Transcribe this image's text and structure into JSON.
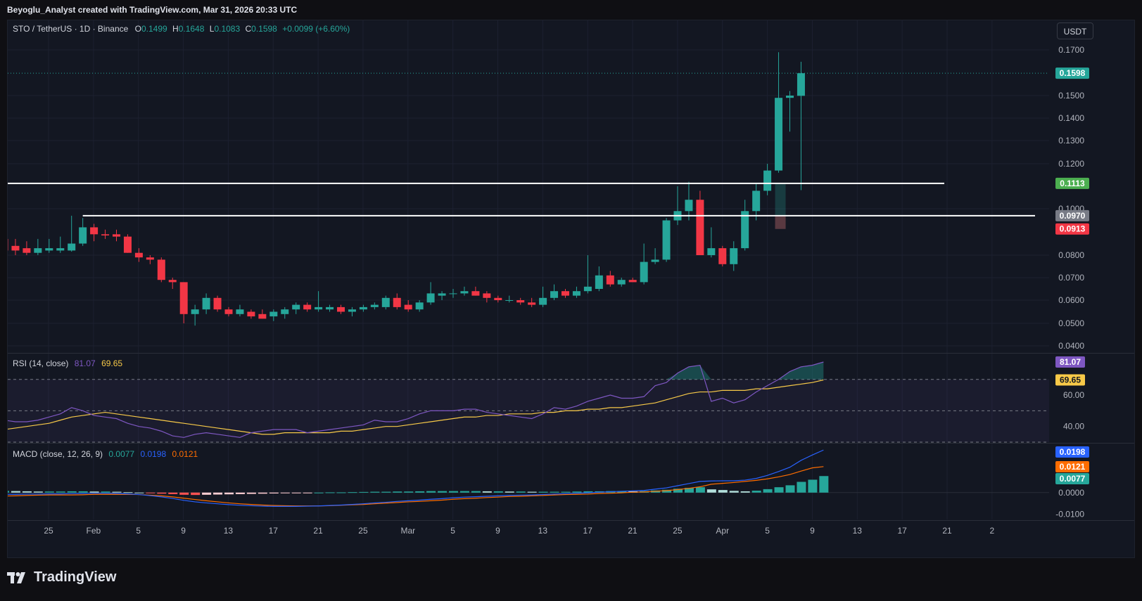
{
  "header": {
    "credit": "Beyoglu_Analyst created with TradingView.com, Mar 31, 2026 20:33 UTC"
  },
  "symbol": {
    "pair": "STO / TetherUS · 1D · Binance",
    "o_label": "O",
    "o_value": "0.1499",
    "h_label": "H",
    "h_value": "0.1648",
    "l_label": "L",
    "l_value": "0.1083",
    "c_label": "C",
    "c_value": "0.1598",
    "change": "+0.0099 (+6.60%)"
  },
  "currency_button": "USDT",
  "rsi": {
    "title": "RSI (14, close)",
    "value": "81.07",
    "ma_value": "69.65"
  },
  "macd": {
    "title": "MACD (close, 12, 26, 9)",
    "hist": "0.0077",
    "macd": "0.0198",
    "signal": "0.0121"
  },
  "branding": "TradingView",
  "colors": {
    "up": "#26a69a",
    "down": "#f23645",
    "rsi_line": "#7e57c2",
    "rsi_ma": "#f7c948",
    "macd_line": "#2962ff",
    "signal_line": "#ff6d00",
    "background": "#131722"
  },
  "chart_data": [
    {
      "type": "candlestick",
      "title": "STO / TetherUS · 1D · Binance",
      "y_axis_ticks": [
        "0.1700",
        "0.1500",
        "0.1400",
        "0.1300",
        "0.1200",
        "0.1000",
        "0.0800",
        "0.0700",
        "0.0600",
        "0.0500",
        "0.0400"
      ],
      "ylim": [
        0.036,
        0.178
      ],
      "x_axis_ticks": [
        "25",
        "Feb",
        "5",
        "9",
        "13",
        "17",
        "21",
        "25",
        "Mar",
        "5",
        "9",
        "13",
        "17",
        "21",
        "25",
        "Apr",
        "5",
        "9",
        "13",
        "17",
        "21",
        "2"
      ],
      "price_badges": [
        {
          "label": "0.1598",
          "value": 0.1598,
          "color": "#26a69a"
        },
        {
          "label": "0.1113",
          "value": 0.1113,
          "color": "#4caf50"
        },
        {
          "label": "0.0970",
          "value": 0.097,
          "color": "#787b86"
        },
        {
          "label": "0.0913",
          "value": 0.0913,
          "color": "#f23645"
        }
      ],
      "horizontal_lines": [
        {
          "value": 0.1113,
          "from": "Jan 19",
          "to": "Apr 14"
        },
        {
          "value": 0.097,
          "from": "Jan 26",
          "to": "Apr 22"
        }
      ],
      "candles": [
        {
          "d": "Jan 19",
          "o": 0.087,
          "h": 0.088,
          "l": 0.081,
          "c": 0.082
        },
        {
          "d": "Jan 20",
          "o": 0.084,
          "h": 0.087,
          "l": 0.08,
          "c": 0.082
        },
        {
          "d": "Jan 21",
          "o": 0.083,
          "h": 0.086,
          "l": 0.08,
          "c": 0.081
        },
        {
          "d": "Jan 22",
          "o": 0.081,
          "h": 0.087,
          "l": 0.08,
          "c": 0.083
        },
        {
          "d": "Jan 23",
          "o": 0.082,
          "h": 0.087,
          "l": 0.081,
          "c": 0.083
        },
        {
          "d": "Jan 24",
          "o": 0.082,
          "h": 0.088,
          "l": 0.081,
          "c": 0.083
        },
        {
          "d": "Jan 25",
          "o": 0.082,
          "h": 0.097,
          "l": 0.0815,
          "c": 0.085
        },
        {
          "d": "Jan 26",
          "o": 0.085,
          "h": 0.096,
          "l": 0.084,
          "c": 0.092
        },
        {
          "d": "Jan 27",
          "o": 0.092,
          "h": 0.0935,
          "l": 0.086,
          "c": 0.089
        },
        {
          "d": "Jan 28",
          "o": 0.089,
          "h": 0.091,
          "l": 0.087,
          "c": 0.0885
        },
        {
          "d": "Jan 29",
          "o": 0.089,
          "h": 0.091,
          "l": 0.086,
          "c": 0.088
        },
        {
          "d": "Jan 30",
          "o": 0.088,
          "h": 0.089,
          "l": 0.081,
          "c": 0.081
        },
        {
          "d": "Jan 31",
          "o": 0.081,
          "h": 0.083,
          "l": 0.077,
          "c": 0.079
        },
        {
          "d": "Feb 1",
          "o": 0.079,
          "h": 0.08,
          "l": 0.076,
          "c": 0.078
        },
        {
          "d": "Feb 2",
          "o": 0.078,
          "h": 0.079,
          "l": 0.068,
          "c": 0.069
        },
        {
          "d": "Feb 3",
          "o": 0.069,
          "h": 0.07,
          "l": 0.065,
          "c": 0.068
        },
        {
          "d": "Feb 4",
          "o": 0.068,
          "h": 0.068,
          "l": 0.05,
          "c": 0.054
        },
        {
          "d": "Feb 5",
          "o": 0.054,
          "h": 0.058,
          "l": 0.049,
          "c": 0.056
        },
        {
          "d": "Feb 6",
          "o": 0.056,
          "h": 0.063,
          "l": 0.054,
          "c": 0.061
        },
        {
          "d": "Feb 7",
          "o": 0.061,
          "h": 0.062,
          "l": 0.055,
          "c": 0.056
        },
        {
          "d": "Feb 8",
          "o": 0.056,
          "h": 0.057,
          "l": 0.053,
          "c": 0.054
        },
        {
          "d": "Feb 9",
          "o": 0.054,
          "h": 0.058,
          "l": 0.053,
          "c": 0.056
        },
        {
          "d": "Feb 10",
          "o": 0.055,
          "h": 0.056,
          "l": 0.052,
          "c": 0.053
        },
        {
          "d": "Feb 11",
          "o": 0.054,
          "h": 0.056,
          "l": 0.052,
          "c": 0.052
        },
        {
          "d": "Feb 12",
          "o": 0.053,
          "h": 0.056,
          "l": 0.051,
          "c": 0.055
        },
        {
          "d": "Feb 13",
          "o": 0.054,
          "h": 0.057,
          "l": 0.052,
          "c": 0.056
        },
        {
          "d": "Feb 14",
          "o": 0.056,
          "h": 0.059,
          "l": 0.054,
          "c": 0.058
        },
        {
          "d": "Feb 15",
          "o": 0.058,
          "h": 0.059,
          "l": 0.055,
          "c": 0.056
        },
        {
          "d": "Feb 16",
          "o": 0.056,
          "h": 0.064,
          "l": 0.055,
          "c": 0.057
        },
        {
          "d": "Feb 17",
          "o": 0.056,
          "h": 0.058,
          "l": 0.055,
          "c": 0.057
        },
        {
          "d": "Feb 18",
          "o": 0.057,
          "h": 0.058,
          "l": 0.054,
          "c": 0.055
        },
        {
          "d": "Feb 19",
          "o": 0.055,
          "h": 0.057,
          "l": 0.053,
          "c": 0.056
        },
        {
          "d": "Feb 20",
          "o": 0.056,
          "h": 0.058,
          "l": 0.055,
          "c": 0.057
        },
        {
          "d": "Feb 21",
          "o": 0.057,
          "h": 0.059,
          "l": 0.056,
          "c": 0.058
        },
        {
          "d": "Feb 22",
          "o": 0.057,
          "h": 0.062,
          "l": 0.056,
          "c": 0.061
        },
        {
          "d": "Feb 23",
          "o": 0.061,
          "h": 0.063,
          "l": 0.056,
          "c": 0.057
        },
        {
          "d": "Feb 24",
          "o": 0.058,
          "h": 0.06,
          "l": 0.055,
          "c": 0.056
        },
        {
          "d": "Feb 25",
          "o": 0.056,
          "h": 0.06,
          "l": 0.055,
          "c": 0.059
        },
        {
          "d": "Feb 26",
          "o": 0.059,
          "h": 0.068,
          "l": 0.058,
          "c": 0.063
        },
        {
          "d": "Feb 27",
          "o": 0.062,
          "h": 0.064,
          "l": 0.06,
          "c": 0.063
        },
        {
          "d": "Feb 28",
          "o": 0.063,
          "h": 0.065,
          "l": 0.061,
          "c": 0.063
        },
        {
          "d": "Mar 1",
          "o": 0.063,
          "h": 0.066,
          "l": 0.062,
          "c": 0.064
        },
        {
          "d": "Mar 2",
          "o": 0.064,
          "h": 0.066,
          "l": 0.062,
          "c": 0.062
        },
        {
          "d": "Mar 3",
          "o": 0.063,
          "h": 0.064,
          "l": 0.059,
          "c": 0.061
        },
        {
          "d": "Mar 4",
          "o": 0.061,
          "h": 0.062,
          "l": 0.059,
          "c": 0.06
        },
        {
          "d": "Mar 5",
          "o": 0.06,
          "h": 0.062,
          "l": 0.059,
          "c": 0.06
        },
        {
          "d": "Mar 6",
          "o": 0.06,
          "h": 0.061,
          "l": 0.058,
          "c": 0.059
        },
        {
          "d": "Mar 7",
          "o": 0.059,
          "h": 0.061,
          "l": 0.057,
          "c": 0.058
        },
        {
          "d": "Mar 8",
          "o": 0.058,
          "h": 0.066,
          "l": 0.057,
          "c": 0.061
        },
        {
          "d": "Mar 9",
          "o": 0.061,
          "h": 0.067,
          "l": 0.06,
          "c": 0.064
        },
        {
          "d": "Mar 10",
          "o": 0.064,
          "h": 0.065,
          "l": 0.061,
          "c": 0.062
        },
        {
          "d": "Mar 11",
          "o": 0.062,
          "h": 0.066,
          "l": 0.061,
          "c": 0.064
        },
        {
          "d": "Mar 12",
          "o": 0.064,
          "h": 0.08,
          "l": 0.063,
          "c": 0.066
        },
        {
          "d": "Mar 13",
          "o": 0.065,
          "h": 0.075,
          "l": 0.064,
          "c": 0.071
        },
        {
          "d": "Mar 14",
          "o": 0.071,
          "h": 0.073,
          "l": 0.066,
          "c": 0.067
        },
        {
          "d": "Mar 15",
          "o": 0.067,
          "h": 0.07,
          "l": 0.066,
          "c": 0.069
        },
        {
          "d": "Mar 16",
          "o": 0.069,
          "h": 0.07,
          "l": 0.068,
          "c": 0.068
        },
        {
          "d": "Mar 17",
          "o": 0.068,
          "h": 0.085,
          "l": 0.067,
          "c": 0.077
        },
        {
          "d": "Mar 18",
          "o": 0.077,
          "h": 0.083,
          "l": 0.076,
          "c": 0.078
        },
        {
          "d": "Mar 19",
          "o": 0.078,
          "h": 0.096,
          "l": 0.077,
          "c": 0.095
        },
        {
          "d": "Mar 20",
          "o": 0.095,
          "h": 0.11,
          "l": 0.093,
          "c": 0.099
        },
        {
          "d": "Mar 21",
          "o": 0.099,
          "h": 0.112,
          "l": 0.095,
          "c": 0.104
        },
        {
          "d": "Mar 22",
          "o": 0.104,
          "h": 0.108,
          "l": 0.08,
          "c": 0.08
        },
        {
          "d": "Mar 23",
          "o": 0.08,
          "h": 0.092,
          "l": 0.079,
          "c": 0.083
        },
        {
          "d": "Mar 24",
          "o": 0.083,
          "h": 0.084,
          "l": 0.075,
          "c": 0.076
        },
        {
          "d": "Mar 25",
          "o": 0.076,
          "h": 0.086,
          "l": 0.073,
          "c": 0.083
        },
        {
          "d": "Mar 26",
          "o": 0.083,
          "h": 0.104,
          "l": 0.082,
          "c": 0.099
        },
        {
          "d": "Mar 27",
          "o": 0.099,
          "h": 0.111,
          "l": 0.095,
          "c": 0.108
        },
        {
          "d": "Mar 28",
          "o": 0.108,
          "h": 0.12,
          "l": 0.106,
          "c": 0.117
        },
        {
          "d": "Mar 29",
          "o": 0.117,
          "h": 0.169,
          "l": 0.116,
          "c": 0.149
        },
        {
          "d": "Mar 30",
          "o": 0.149,
          "h": 0.152,
          "l": 0.134,
          "c": 0.15
        },
        {
          "d": "Mar 31",
          "o": 0.1499,
          "h": 0.1648,
          "l": 0.1083,
          "c": 0.1598
        }
      ]
    },
    {
      "type": "line",
      "title": "RSI (14, close)",
      "y_axis_ticks": [
        "60.00",
        "40.00"
      ],
      "ylim": [
        30,
        86
      ],
      "bands": [
        70,
        50,
        30
      ],
      "series": [
        {
          "values": [
            44,
            43,
            43,
            44,
            46,
            48,
            52,
            50,
            47,
            46,
            45,
            42,
            40,
            39,
            37,
            34,
            33,
            35,
            36,
            35,
            34,
            33,
            36,
            37,
            38,
            38,
            38,
            36,
            37,
            38,
            39,
            40,
            41,
            44,
            43,
            43,
            45,
            48,
            50,
            50,
            50,
            51,
            51,
            49,
            48,
            47,
            46,
            45,
            48,
            52,
            51,
            53,
            56,
            58,
            60,
            58,
            58,
            59,
            66,
            68,
            74,
            78,
            79,
            56,
            58,
            55,
            57,
            62,
            66,
            70,
            75,
            78,
            79,
            81.07
          ]
        },
        {
          "values": [
            38,
            39,
            40,
            41,
            42,
            44,
            46,
            47,
            48,
            49,
            48,
            47,
            46,
            45,
            44,
            43,
            42,
            41,
            40,
            39,
            38,
            37,
            36,
            35,
            35,
            36,
            36,
            36,
            36,
            36,
            37,
            37,
            38,
            39,
            40,
            40,
            41,
            42,
            43,
            44,
            45,
            46,
            46,
            47,
            47,
            48,
            48,
            48,
            49,
            49,
            50,
            50,
            51,
            51,
            52,
            52,
            53,
            54,
            55,
            57,
            59,
            61,
            62,
            62,
            63,
            63,
            63,
            64,
            64,
            65,
            66,
            67,
            68,
            69.65
          ]
        }
      ]
    },
    {
      "type": "bar",
      "title": "MACD (close, 12, 26, 9)",
      "y_axis_ticks": [
        "0.0000",
        "-0.0100"
      ],
      "ylim": [
        -0.0125,
        0.0225
      ],
      "value_badges": [
        "0.0198",
        "0.0121",
        "0.0077"
      ],
      "series": [
        {
          "values": [
            0.0008,
            0.0007,
            0.0006,
            0.0005,
            0.0005,
            0.0005,
            0.0006,
            0.0006,
            0.0005,
            0.0005,
            0.0004,
            0.0002,
            0.0,
            -0.0002,
            -0.0005,
            -0.0007,
            -0.001,
            -0.0011,
            -0.001,
            -0.0009,
            -0.0008,
            -0.0007,
            -0.0006,
            -0.0005,
            -0.0004,
            -0.0003,
            -0.0002,
            -0.0001,
            0.0,
            0.0001,
            0.0001,
            0.0002,
            0.0003,
            0.0004,
            0.0004,
            0.0005,
            0.0005,
            0.0006,
            0.0007,
            0.0007,
            0.0007,
            0.0007,
            0.0007,
            0.0006,
            0.0006,
            0.0005,
            0.0005,
            0.0004,
            0.0004,
            0.0004,
            0.0004,
            0.0005,
            0.0006,
            0.0006,
            0.0007,
            0.0007,
            0.0006,
            0.0007,
            0.001,
            0.0013,
            0.0018,
            0.0022,
            0.0025,
            0.0015,
            0.0012,
            0.0008,
            0.0006,
            0.0009,
            0.0016,
            0.0025,
            0.0034,
            0.005,
            0.006,
            0.0077
          ]
        },
        {
          "values": [
            -0.0008,
            -0.0008,
            -0.0007,
            -0.0007,
            -0.0006,
            -0.0006,
            -0.0005,
            -0.0004,
            -0.0003,
            -0.0003,
            -0.0004,
            -0.0006,
            -0.0009,
            -0.0014,
            -0.002,
            -0.0027,
            -0.0036,
            -0.0043,
            -0.0048,
            -0.0052,
            -0.0056,
            -0.0059,
            -0.0061,
            -0.0063,
            -0.0064,
            -0.0064,
            -0.0064,
            -0.0063,
            -0.0062,
            -0.006,
            -0.0058,
            -0.0055,
            -0.0052,
            -0.0048,
            -0.0045,
            -0.0041,
            -0.0038,
            -0.0035,
            -0.0031,
            -0.0028,
            -0.0024,
            -0.0021,
            -0.0019,
            -0.0017,
            -0.0015,
            -0.0013,
            -0.0012,
            -0.0011,
            -0.0009,
            -0.0007,
            -0.0005,
            -0.0003,
            -0.0001,
            0.0002,
            0.0004,
            0.0006,
            0.0008,
            0.001,
            0.0016,
            0.0022,
            0.0032,
            0.0042,
            0.0052,
            0.0054,
            0.0055,
            0.0055,
            0.0058,
            0.0066,
            0.008,
            0.0098,
            0.0118,
            0.015,
            0.0175,
            0.0198
          ]
        },
        {
          "values": [
            -0.0016,
            -0.0015,
            -0.0013,
            -0.0012,
            -0.0011,
            -0.0011,
            -0.0011,
            -0.001,
            -0.0008,
            -0.0008,
            -0.0008,
            -0.0008,
            -0.0009,
            -0.0012,
            -0.0015,
            -0.002,
            -0.0026,
            -0.0032,
            -0.0038,
            -0.0043,
            -0.0048,
            -0.0052,
            -0.0055,
            -0.0058,
            -0.006,
            -0.0061,
            -0.0062,
            -0.0062,
            -0.0062,
            -0.0061,
            -0.0059,
            -0.0057,
            -0.0055,
            -0.0052,
            -0.0049,
            -0.0046,
            -0.0043,
            -0.0041,
            -0.0038,
            -0.0035,
            -0.0031,
            -0.0028,
            -0.0026,
            -0.0023,
            -0.0021,
            -0.0018,
            -0.0017,
            -0.0015,
            -0.0013,
            -0.0011,
            -0.0009,
            -0.0008,
            -0.0007,
            -0.0004,
            -0.0003,
            -0.0001,
            0.0002,
            0.0003,
            0.0006,
            0.0009,
            0.0014,
            0.002,
            0.0027,
            0.0039,
            0.0043,
            0.0047,
            0.0052,
            0.0057,
            0.0064,
            0.0073,
            0.0084,
            0.01,
            0.0115,
            0.0121
          ]
        }
      ]
    }
  ]
}
